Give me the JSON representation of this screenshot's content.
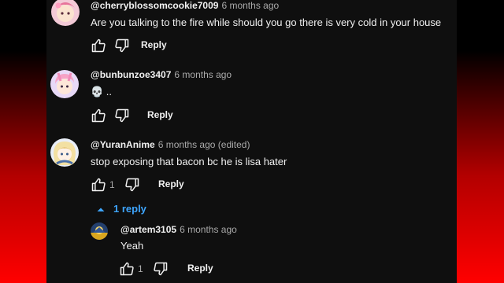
{
  "comments": [
    {
      "author": "@cherryblossomcookie7009",
      "time": "6 months ago",
      "text": "Are you talking to the fire while should you go there is very cold in your house",
      "likes": "",
      "reply_label": "Reply"
    },
    {
      "author": "@bunbunzoe3407",
      "time": "6 months ago",
      "text": "💀 ..",
      "likes": "",
      "reply_label": "Reply"
    },
    {
      "author": "@YuranAnime",
      "time": "6 months ago (edited)",
      "text": "stop exposing that bacon bc he is lisa hater",
      "likes": "1",
      "reply_label": "Reply"
    }
  ],
  "replies_toggle": {
    "label": "1 reply",
    "color": "#3ea6ff"
  },
  "reply": {
    "author": "@artem3105",
    "time": "6 months ago",
    "text": "Yeah",
    "likes": "1",
    "reply_label": "Reply"
  },
  "icons": [
    "thumbs-up-icon",
    "thumbs-down-icon",
    "chevron-up-icon"
  ],
  "colors": {
    "background_top": "#000000",
    "background_bottom": "#ff0000",
    "panel": "#0f0f0f",
    "text": "#f1f1f1",
    "muted": "#aaaaaa",
    "link": "#3ea6ff"
  }
}
